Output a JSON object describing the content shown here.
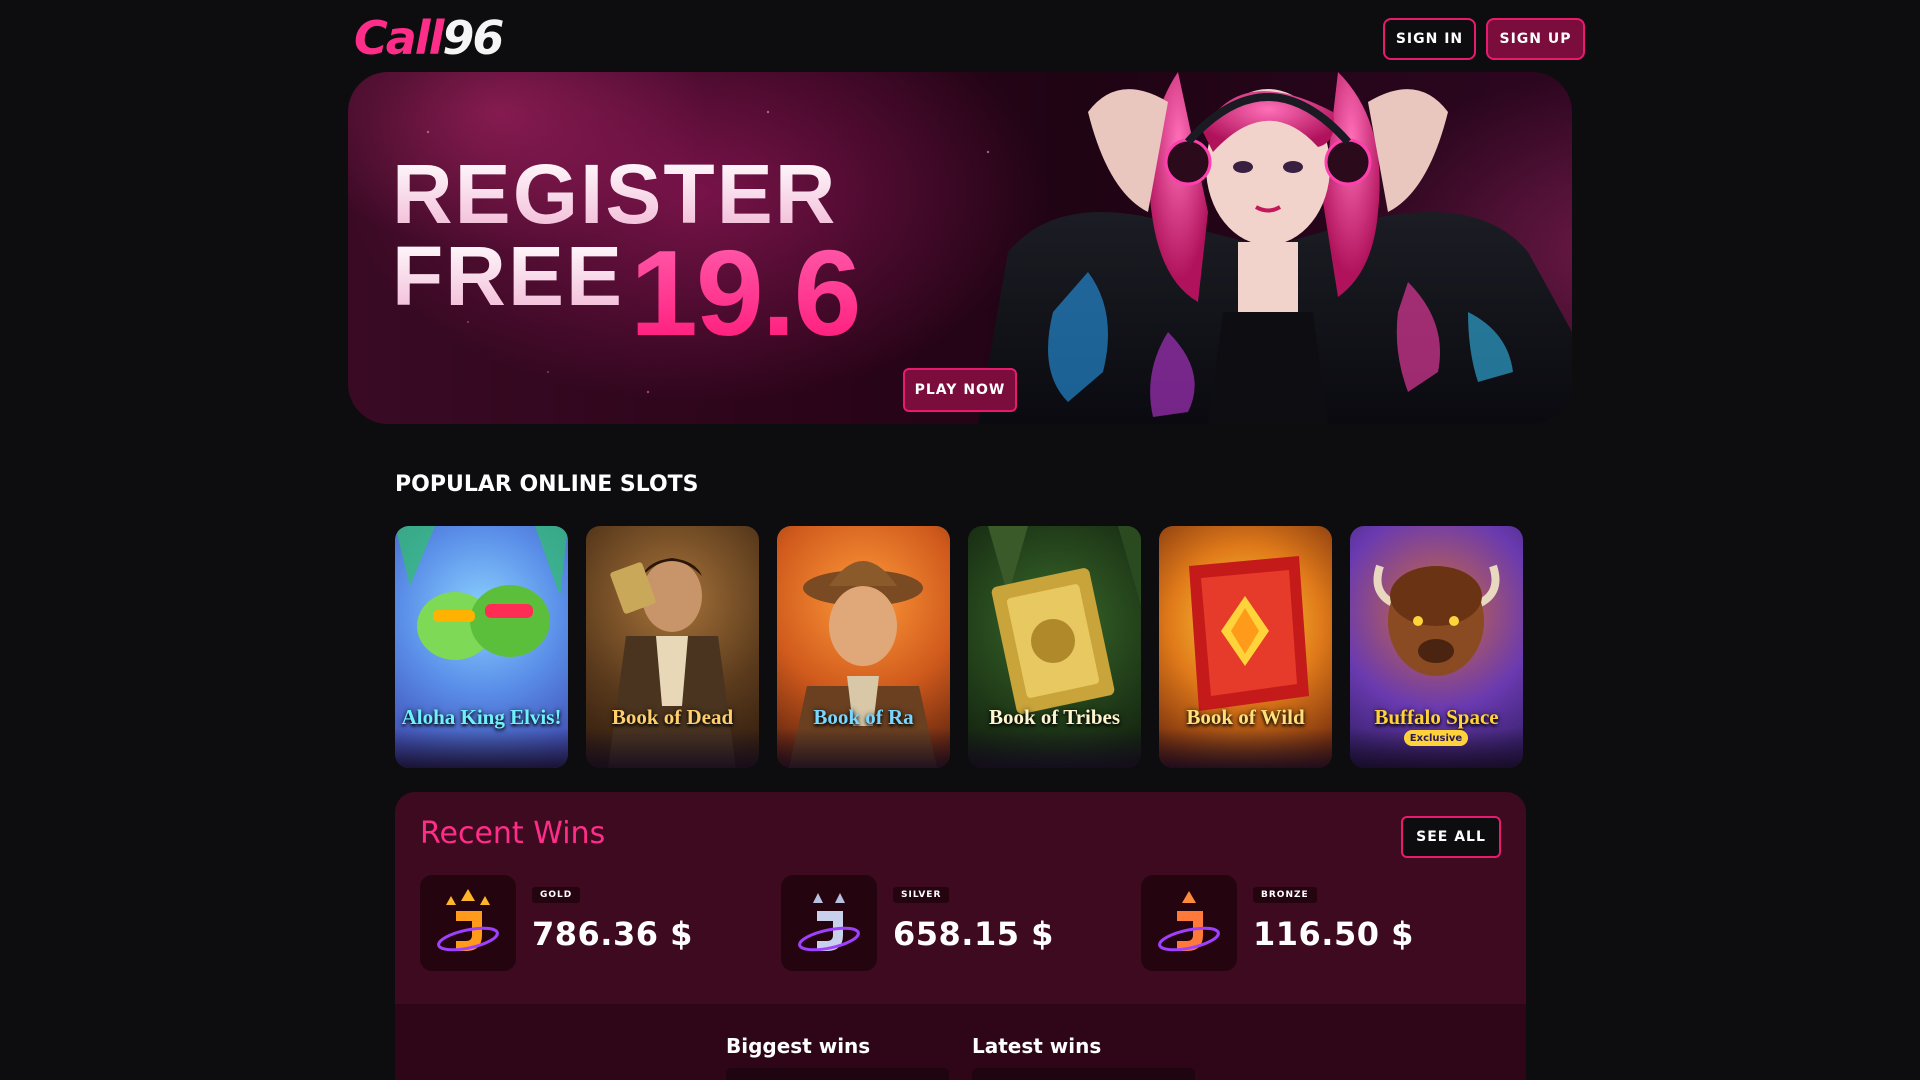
{
  "brand": {
    "logo_part1": "Call",
    "logo_part2": "96"
  },
  "header": {
    "signin_label": "SIGN IN",
    "signup_label": "SIGN UP"
  },
  "banner": {
    "line1": "REGISTER",
    "line2": "FREE",
    "amount": "19.6",
    "cta_label": "PLAY NOW"
  },
  "popular": {
    "title": "POPULAR ONLINE SLOTS",
    "slots": [
      {
        "name": "Aloha King Elvis!"
      },
      {
        "name": "Book of Dead"
      },
      {
        "name": "Book of Ra"
      },
      {
        "name": "Book of Tribes"
      },
      {
        "name": "Book of Wild"
      },
      {
        "name": "Buffalo Space"
      }
    ],
    "slot6_badge": "Exclusive"
  },
  "recent_wins": {
    "title": "Recent Wins",
    "see_all_label": "SEE ALL",
    "cards": [
      {
        "tier": "GOLD",
        "amount": "786.36 $"
      },
      {
        "tier": "SILVER",
        "amount": "658.15 $"
      },
      {
        "tier": "BRONZE",
        "amount": "116.50 $"
      }
    ],
    "tabs": {
      "biggest": "Biggest wins",
      "latest": "Latest wins"
    }
  },
  "colors": {
    "accent": "#e81a6e",
    "brand_pink": "#ff2d8a",
    "panel": "#3e0a1f"
  }
}
